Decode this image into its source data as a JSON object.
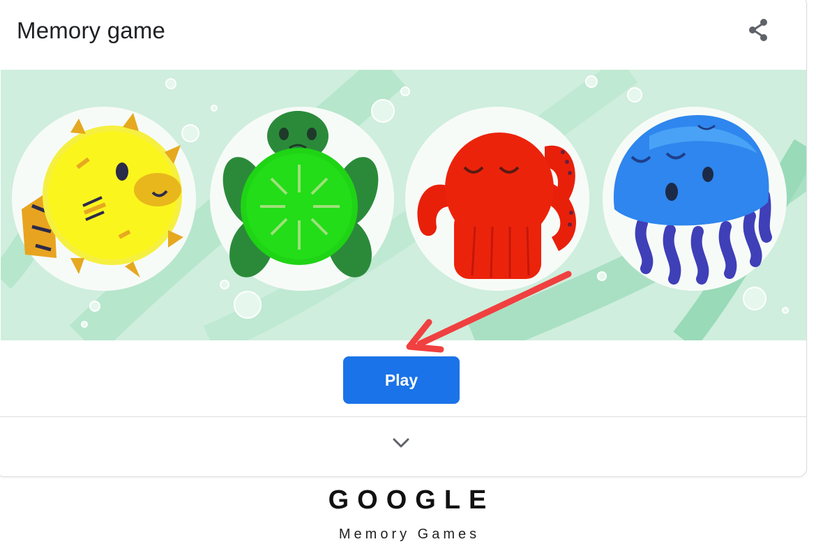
{
  "card": {
    "title": "Memory game",
    "share_icon": "share-icon",
    "expand_icon": "chevron-down-icon"
  },
  "banner": {
    "characters": [
      "pufferfish",
      "turtle",
      "octopus",
      "jellyfish"
    ]
  },
  "play": {
    "label": "Play"
  },
  "annotation": {
    "arrow_color": "#f04040"
  },
  "footer": {
    "brand": "GOOGLE",
    "subtitle": "Memory Games"
  },
  "colors": {
    "button": "#1a73e8",
    "banner_bg": "#cfeedd",
    "text": "#202124"
  }
}
